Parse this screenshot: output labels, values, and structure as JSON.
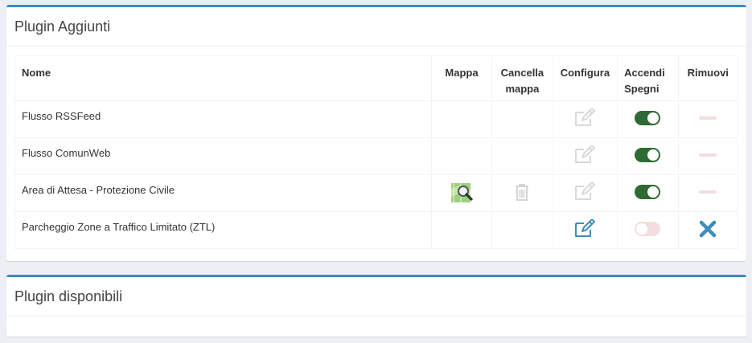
{
  "installed": {
    "title": "Plugin Aggiunti",
    "columns": {
      "name": "Nome",
      "map": "Mappa",
      "delete_map_1": "Cancella",
      "delete_map_2": "mappa",
      "configure": "Configura",
      "toggle_1": "Accendi",
      "toggle_2": "Spegni",
      "remove": "Rimuovi"
    },
    "rows": [
      {
        "name": "Flusso RSSFeed",
        "has_map": false,
        "configurable": false,
        "enabled": true,
        "removable": false
      },
      {
        "name": "Flusso ComunWeb",
        "has_map": false,
        "configurable": false,
        "enabled": true,
        "removable": false
      },
      {
        "name": "Area di Attesa - Protezione Civile",
        "has_map": true,
        "configurable": false,
        "enabled": true,
        "removable": false
      },
      {
        "name": "Parcheggio Zone a Traffico Limitato (ZTL)",
        "has_map": false,
        "configurable": true,
        "enabled": false,
        "removable": true
      }
    ]
  },
  "available": {
    "title": "Plugin disponibili"
  },
  "colors": {
    "accent": "#3c8dbc",
    "toggle_on": "#2e6b34",
    "toggle_off": "#f2dede",
    "remove": "#3c8dbc"
  }
}
